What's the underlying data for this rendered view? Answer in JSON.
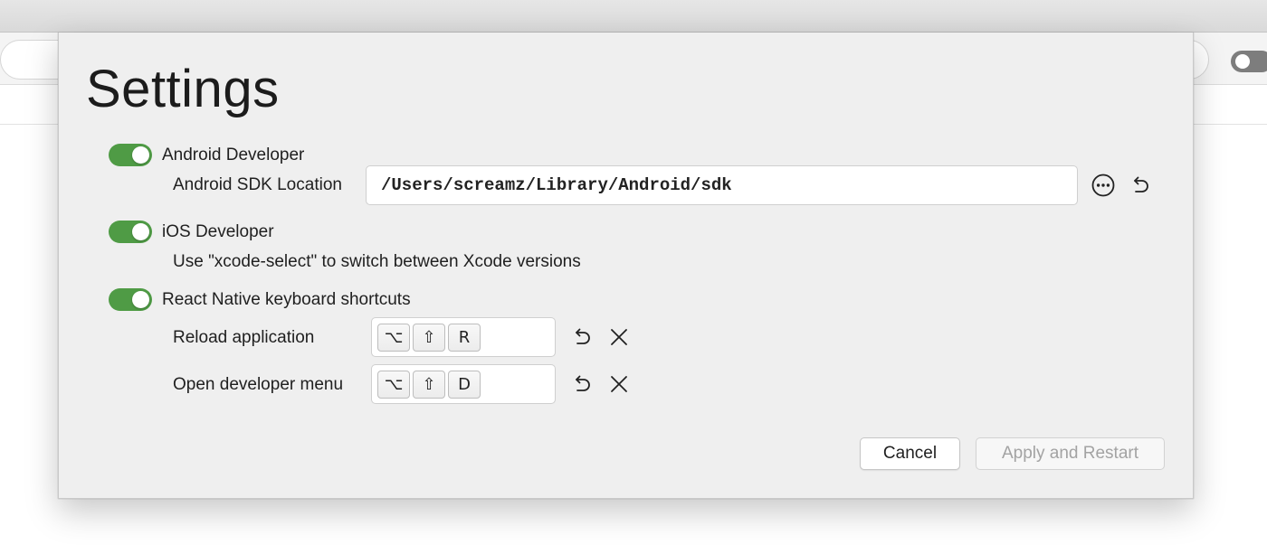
{
  "dialog": {
    "title": "Settings"
  },
  "android": {
    "toggle_label": "Android Developer",
    "enabled": true,
    "sdk_label": "Android SDK Location",
    "sdk_path": "/Users/screamz/Library/Android/sdk",
    "browse_icon": "more-icon",
    "reset_icon": "undo-icon"
  },
  "ios": {
    "toggle_label": "iOS Developer",
    "enabled": true,
    "hint": "Use \"xcode-select\" to switch between Xcode versions"
  },
  "react_native": {
    "toggle_label": "React Native keyboard shortcuts",
    "enabled": true,
    "shortcuts": [
      {
        "label": "Reload application",
        "keys": [
          "⌥",
          "⇧",
          "R"
        ]
      },
      {
        "label": "Open developer menu",
        "keys": [
          "⌥",
          "⇧",
          "D"
        ]
      }
    ]
  },
  "buttons": {
    "cancel": "Cancel",
    "apply": "Apply and Restart"
  },
  "colors": {
    "toggle_on": "#4f9b45",
    "dialog_bg": "#efefef",
    "disabled_text": "#a3a3a3"
  }
}
